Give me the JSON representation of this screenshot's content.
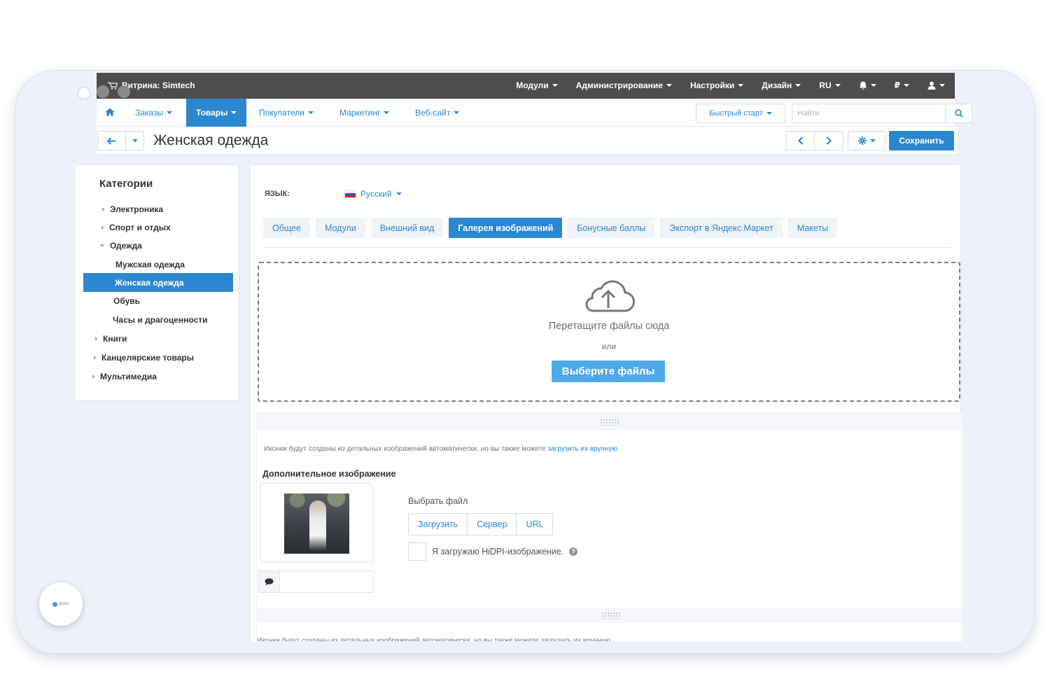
{
  "header": {
    "store_label": "Витрина: Simtech",
    "menu": [
      "Модули",
      "Администрирование",
      "Настройки",
      "Дизайн",
      "RU",
      "",
      "₽",
      ""
    ]
  },
  "subnav": {
    "items": [
      "Заказы",
      "Товары",
      "Покупатели",
      "Маркетинг",
      "Веб-сайт"
    ],
    "active": "Товары",
    "quickstart": "Быстрый старт",
    "search_placeholder": "Найти"
  },
  "titlebar": {
    "title": "Женская одежда",
    "save_label": "Сохранить"
  },
  "sidebar": {
    "heading": "Категории",
    "items": [
      {
        "label": "Электроника",
        "level": 0,
        "expander": "right"
      },
      {
        "label": "Спорт и отдых",
        "level": 0,
        "expander": "right"
      },
      {
        "label": "Одежда",
        "level": 0,
        "expander": "down"
      },
      {
        "label": "Мужская одежда",
        "level": 1
      },
      {
        "label": "Женская одежда",
        "level": 1,
        "active": true
      },
      {
        "label": "Обувь",
        "level": 1
      },
      {
        "label": "Часы и драгоценности",
        "level": 1
      },
      {
        "label": "Книги",
        "level": 0,
        "expander": "right"
      },
      {
        "label": "Канцелярские товары",
        "level": 0,
        "expander": "right"
      },
      {
        "label": "Мультимедиа",
        "level": 0,
        "expander": "right"
      }
    ]
  },
  "main": {
    "lang_label": "ЯЗЫК:",
    "lang_value": "Русский",
    "tabs": [
      "Общее",
      "Модули",
      "Внешний вид",
      "Галерея изображений",
      "Бонусные баллы",
      "Экспорт в Яндекс.Маркет",
      "Макеты"
    ],
    "active_tab": "Галерея изображений",
    "dropzone": {
      "text": "Перетащите файлы сюда",
      "or": "или",
      "button": "Выберите файлы"
    },
    "image_section": {
      "hint_text": "Иконки будут созданы из детальных изображений автоматически, но вы также можете ",
      "hint_link": "загрузить их вручную",
      "hint_end": ".",
      "subheading": "Дополнительное изображение",
      "choose_label": "Выбрать файл",
      "sources": [
        "Загрузить",
        "Сервер",
        "URL"
      ],
      "hidpi_label": "Я загружаю HiDPI-изображение."
    }
  },
  "badge": {
    "label": "ДЕМО"
  },
  "colors": {
    "accent": "#2b88d0",
    "topbar": "#4d4d4d",
    "link": "#2a87cf",
    "dropzone_button": "#4ea9e8"
  }
}
